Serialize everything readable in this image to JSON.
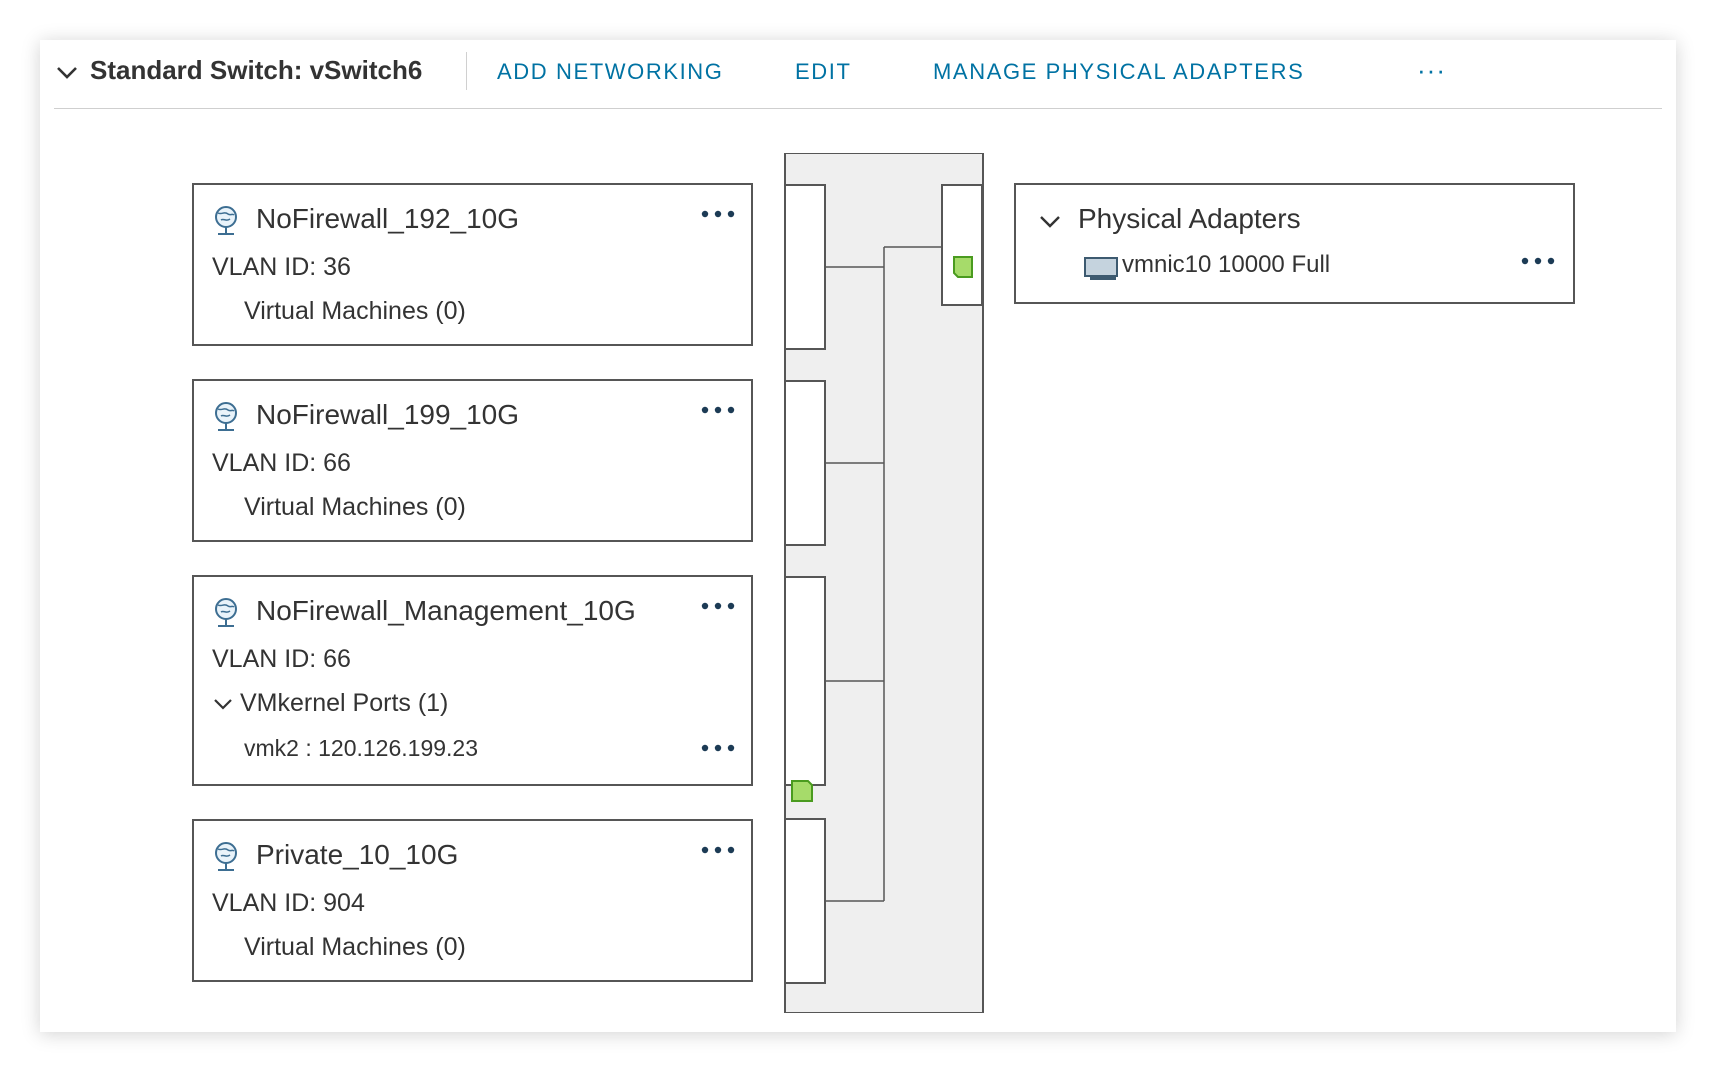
{
  "header": {
    "title": "Standard Switch: vSwitch6",
    "actions": {
      "add_networking": "ADD NETWORKING",
      "edit": "EDIT",
      "manage_physical_adapters": "MANAGE PHYSICAL ADAPTERS"
    },
    "more": "···"
  },
  "port_groups": [
    {
      "name": "NoFirewall_192_10G",
      "vlan": "VLAN ID: 36",
      "sub": "Virtual Machines (0)"
    },
    {
      "name": "NoFirewall_199_10G",
      "vlan": "VLAN ID: 66",
      "sub": "Virtual Machines (0)"
    },
    {
      "name": "NoFirewall_Management_10G",
      "vlan": "VLAN ID: 66",
      "sub": "VMkernel Ports (1)",
      "vmk_item": "vmk2 : 120.126.199.23"
    },
    {
      "name": "Private_10_10G",
      "vlan": "VLAN ID: 904",
      "sub": "Virtual Machines (0)"
    }
  ],
  "physical_adapters": {
    "title": "Physical Adapters",
    "items": [
      {
        "label": "vmnic10 10000 Full"
      }
    ]
  },
  "colors": {
    "accent": "#0072a3",
    "port_green": "#a6db6a",
    "port_green_border": "#4a9b1f",
    "switch_fill": "#efefef",
    "border": "#565656"
  },
  "icons": {
    "header_toggle": "chevron-down-icon",
    "port_group": "network-globe-icon",
    "more": "more-dots-icon",
    "vmk_port": "vmkernel-port-icon",
    "physical_nic": "physical-nic-icon",
    "uplink_port": "uplink-port-icon"
  }
}
